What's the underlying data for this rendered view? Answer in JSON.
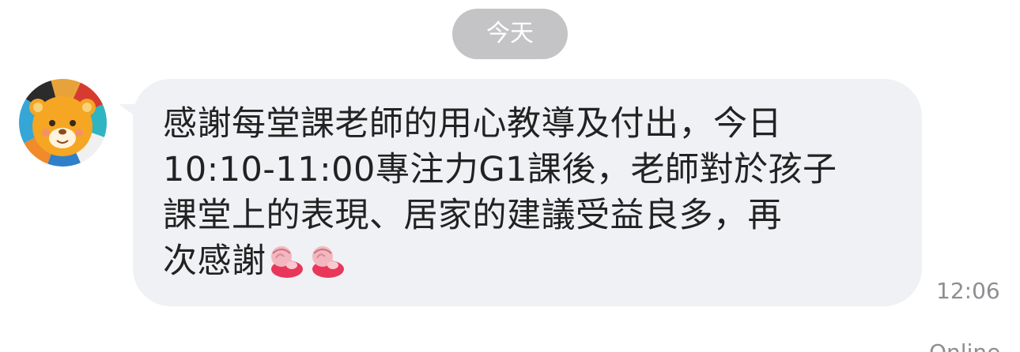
{
  "date_divider": {
    "label": "今天"
  },
  "message": {
    "sender_avatar_icon": "lion-avatar-icon",
    "text_lines": [
      "感謝每堂課老師的用心教導及付出，今日",
      "10:10-11:00專注力G1課後，老師對於孩子",
      "課堂上的表現、居家的建議受益良多，再",
      "次感謝"
    ],
    "emoji_icons": [
      "bowing-person-emoji-icon",
      "bowing-person-emoji-icon"
    ],
    "time": "12:06"
  },
  "next_message_partial": {
    "text": "Online"
  },
  "colors": {
    "bubble_background": "#eff1f4",
    "date_pill_background": "#c4c4c6",
    "text": "#222222",
    "timestamp": "#8e8e93"
  }
}
